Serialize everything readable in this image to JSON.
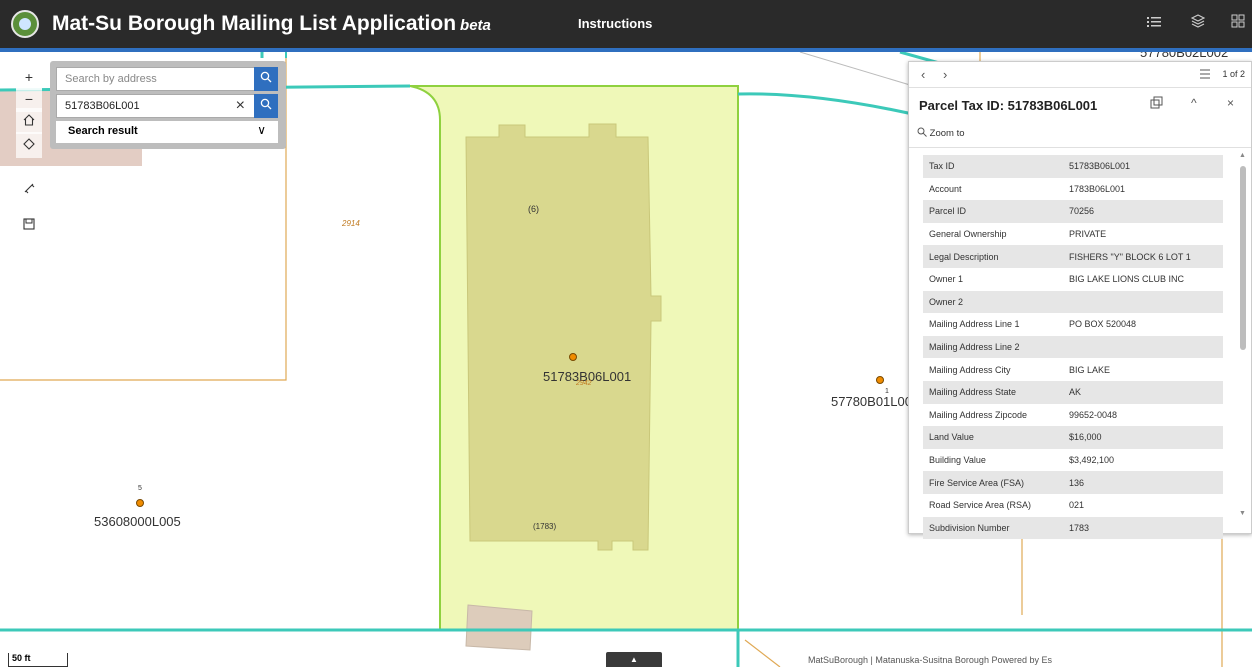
{
  "header": {
    "title": "Mat-Su Borough Mailing List Application",
    "beta": "beta",
    "instructions": "Instructions",
    "icons": [
      "list-icon",
      "layers-icon",
      "grid-icon"
    ]
  },
  "search": {
    "address_placeholder": "Search by address",
    "parcel_value": "51783B06L001",
    "result_label": "Search result"
  },
  "map": {
    "labels": {
      "road_number": "2914",
      "block_number": "(6)",
      "main_parcel": "51783B06L001",
      "main_parcel_sub": "2942",
      "parcel_right": "57780B01L00",
      "parcel_right_num": "1",
      "parcel_left": "53608000L005",
      "parcel_left_num": "5",
      "parcel_top_right": "57780B02L002",
      "subdivision": "(1783)"
    },
    "scale": "50 ft",
    "attribution": "MatSuBorough | Matanuska-Susitna Borough   Powered by Es"
  },
  "popup": {
    "count": "1 of 2",
    "title": "Parcel Tax ID: 51783B06L001",
    "zoom_to": "Zoom to",
    "attributes": [
      {
        "key": "Tax ID",
        "value": "51783B06L001"
      },
      {
        "key": "Account",
        "value": "1783B06L001"
      },
      {
        "key": "Parcel ID",
        "value": "70256"
      },
      {
        "key": "General Ownership",
        "value": "PRIVATE"
      },
      {
        "key": "Legal Description",
        "value": "FISHERS \"Y\" BLOCK 6 LOT 1"
      },
      {
        "key": "Owner 1",
        "value": "BIG LAKE LIONS CLUB INC"
      },
      {
        "key": "Owner 2",
        "value": ""
      },
      {
        "key": "Mailing Address Line 1",
        "value": "PO BOX 520048"
      },
      {
        "key": "Mailing Address Line 2",
        "value": ""
      },
      {
        "key": "Mailing Address City",
        "value": "BIG LAKE"
      },
      {
        "key": "Mailing Address State",
        "value": "AK"
      },
      {
        "key": "Mailing Address Zipcode",
        "value": "99652-0048"
      },
      {
        "key": "Land Value",
        "value": "$16,000"
      },
      {
        "key": "Building Value",
        "value": "$3,492,100"
      },
      {
        "key": "Fire Service Area (FSA)",
        "value": "136"
      },
      {
        "key": "Road Service Area (RSA)",
        "value": "021"
      },
      {
        "key": "Subdivision Number",
        "value": "1783"
      }
    ]
  },
  "colors": {
    "header_bg": "#2a2a2a",
    "accent": "#2f6fbf",
    "parcel_fill": "#eff8b8",
    "parcel_outline": "#8fd13f",
    "building_fill": "#d9d88e",
    "road_line": "#3cc9b9",
    "boundary_line": "#e0a955",
    "point_fill": "#f08c00"
  }
}
